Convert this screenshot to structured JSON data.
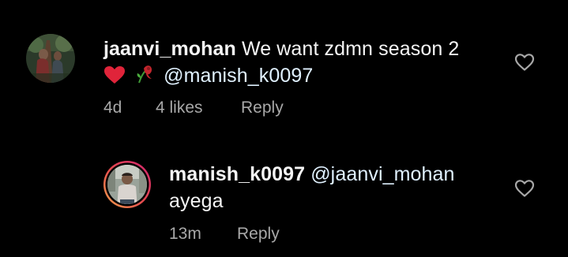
{
  "comments": [
    {
      "username": "jaanvi_mohan",
      "text": "We want zdmn season 2",
      "emoji_1": "heart-emoji",
      "emoji_2": "wilted-flower-emoji",
      "mention": "@manish_k0097",
      "time": "4d",
      "likes": "4 likes",
      "reply_label": "Reply",
      "like_icon": "heart-outline-icon"
    },
    {
      "username": "manish_k0097",
      "mention": "@jaanvi_mohan",
      "text": "ayega",
      "time": "13m",
      "reply_label": "Reply",
      "like_icon": "heart-outline-icon",
      "story_ring": true
    }
  ],
  "colors": {
    "background": "#000000",
    "text": "#f5f5f5",
    "secondary_text": "#a8a8a8",
    "mention": "#e0f1ff",
    "heart_emoji": "#e0243a",
    "story_ring_start": "#f2a14a",
    "story_ring_end": "#d1246f"
  }
}
